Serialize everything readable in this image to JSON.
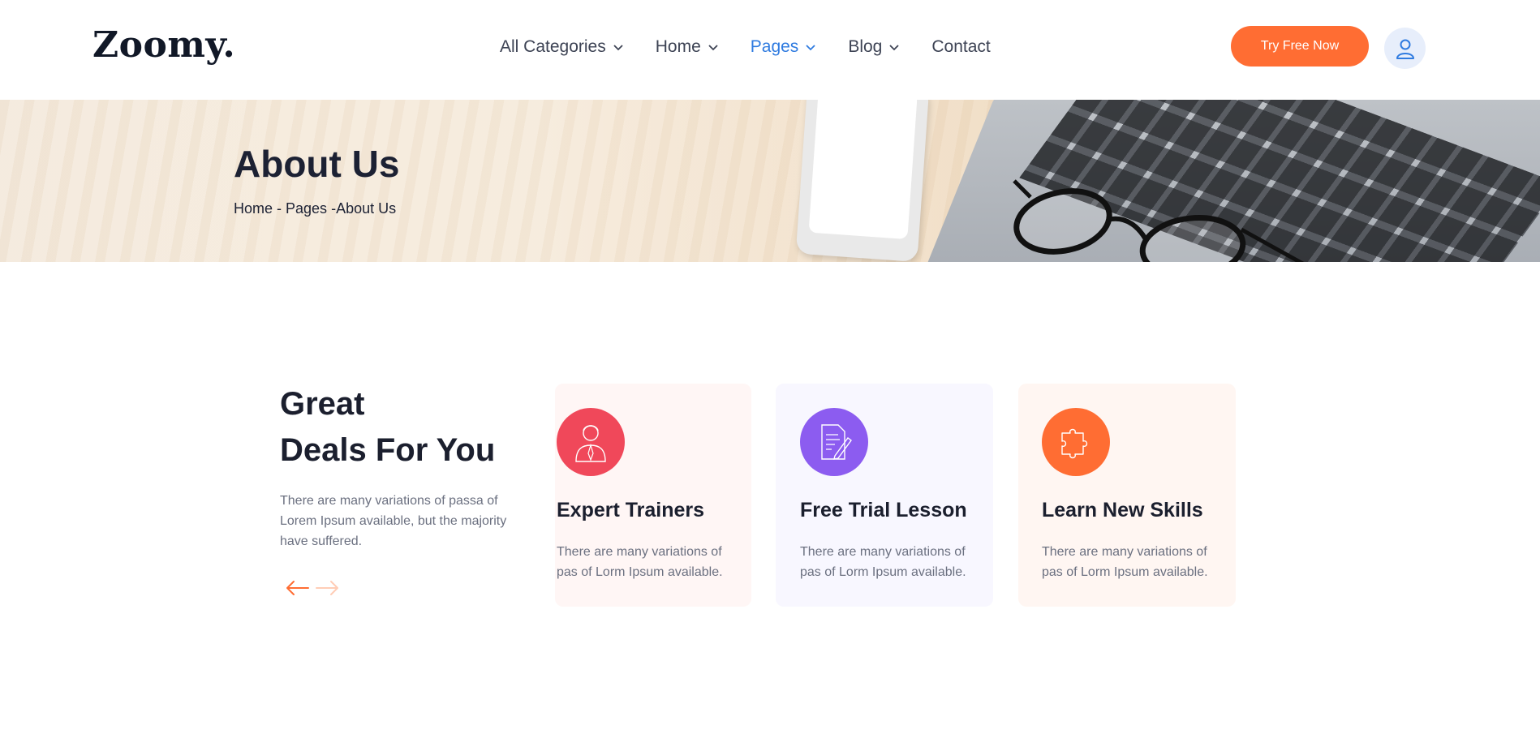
{
  "brand": {
    "logo_text": "Zoomy."
  },
  "nav": {
    "items": [
      {
        "label": "All Categories",
        "has_dropdown": true,
        "active": false
      },
      {
        "label": "Home",
        "has_dropdown": true,
        "active": false
      },
      {
        "label": "Pages",
        "has_dropdown": true,
        "active": true
      },
      {
        "label": "Blog",
        "has_dropdown": true,
        "active": false
      },
      {
        "label": "Contact",
        "has_dropdown": false,
        "active": false
      }
    ],
    "cta_label": "Try Free Now",
    "user_icon": "user-icon"
  },
  "hero": {
    "title": "About Us",
    "breadcrumb": {
      "home": "Home",
      "sep1": " - ",
      "pages": "Pages",
      "sep2": " -",
      "current": "About Us"
    }
  },
  "deals": {
    "title_line1": "Great",
    "title_line2": "Deals For You",
    "description": "There are many variations of passa of Lorem Ipsum available, but the majority have suffered.",
    "prev_icon": "arrow-left-icon",
    "next_icon": "arrow-right-icon"
  },
  "cards": [
    {
      "title": "Expert Trainers",
      "text": "There are many variations of pas of Lorm Ipsum available.",
      "icon": "trainer-icon",
      "icon_color": "#f0485a"
    },
    {
      "title": "Free Trial Lesson",
      "text": "There are many variations of pas of Lorm Ipsum available.",
      "icon": "document-edit-icon",
      "icon_color": "#8c5cf0"
    },
    {
      "title": "Learn New Skills",
      "text": "There are many variations of pas of Lorm Ipsum available.",
      "icon": "puzzle-icon",
      "icon_color": "#ff6d33"
    }
  ],
  "colors": {
    "accent": "#ff6d33",
    "nav_active": "#2f7be0",
    "heading": "#1b1f2e"
  }
}
